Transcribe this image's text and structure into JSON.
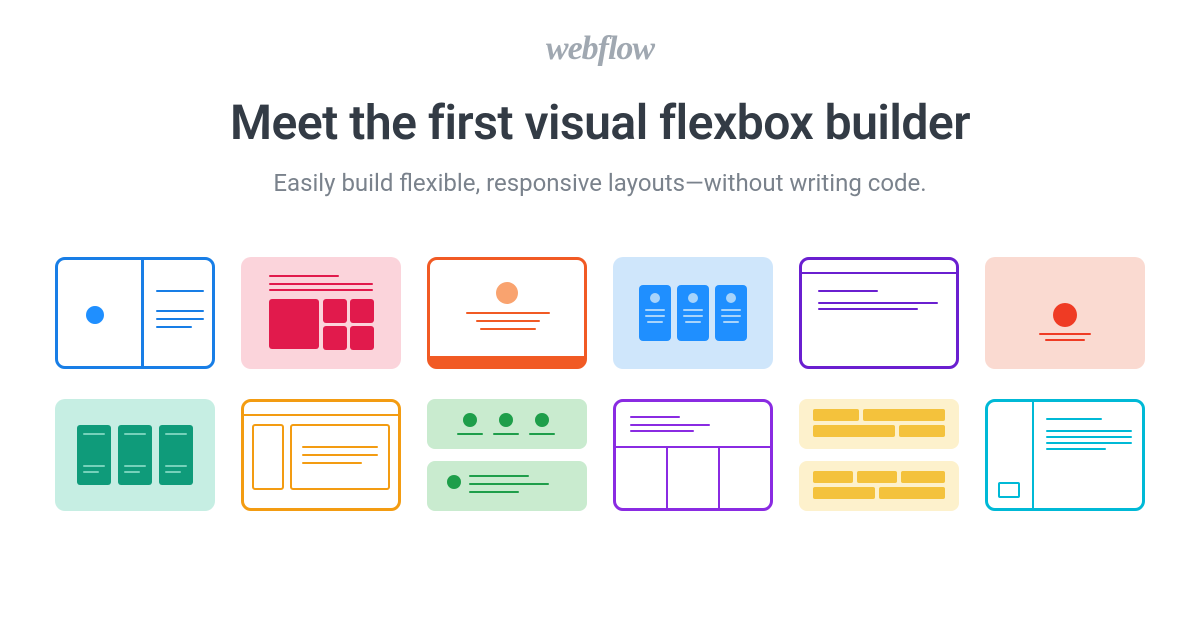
{
  "brand": {
    "name": "webflow"
  },
  "hero": {
    "headline": "Meet the first visual flexbox builder",
    "subhead": "Easily build flexible, responsive layouts—without writing code."
  },
  "tiles": [
    {
      "name": "layout-split-two-column",
      "accent": "#187ee6"
    },
    {
      "name": "layout-media-grid",
      "accent": "#e11a4c"
    },
    {
      "name": "layout-hero-centered",
      "accent": "#f15a24"
    },
    {
      "name": "layout-card-row",
      "accent": "#1f8fff"
    },
    {
      "name": "layout-browser-page",
      "accent": "#6a1fd0"
    },
    {
      "name": "layout-spotlight",
      "accent": "#ef3b24"
    },
    {
      "name": "layout-column-cards",
      "accent": "#0f9b7a"
    },
    {
      "name": "layout-sidebar-content",
      "accent": "#f39c12"
    },
    {
      "name": "layout-feature-list",
      "accent": "#1e9e4a"
    },
    {
      "name": "layout-grid-sections",
      "accent": "#8a2be2"
    },
    {
      "name": "layout-masonry-bricks",
      "accent": "#f4c23c"
    },
    {
      "name": "layout-document-reader",
      "accent": "#00b9d6"
    }
  ]
}
